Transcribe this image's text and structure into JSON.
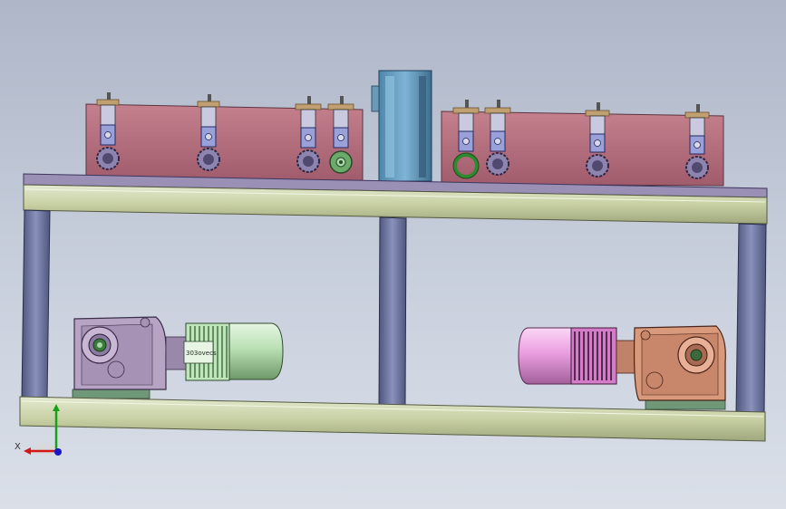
{
  "viewport": {
    "background_top": "#aeb6c8",
    "background_bottom": "#dadfe8"
  },
  "motors": {
    "left": {
      "brand_text": "303ovecs",
      "gearbox_color": "#b7a4c4",
      "motor_color": "#b9e0b4"
    },
    "right": {
      "gearbox_color": "#d99a7c",
      "motor_color": "#ea9ee0"
    }
  },
  "frame": {
    "beam_color": "#c8d0a4",
    "post_color": "#6f78a4",
    "plate_color": "#b16a7a",
    "table_top_color": "#9a8fb4"
  },
  "triad": {
    "x_label": "X",
    "x_color": "#d01818",
    "y_color": "#18a018",
    "z_color": "#1818c8"
  }
}
